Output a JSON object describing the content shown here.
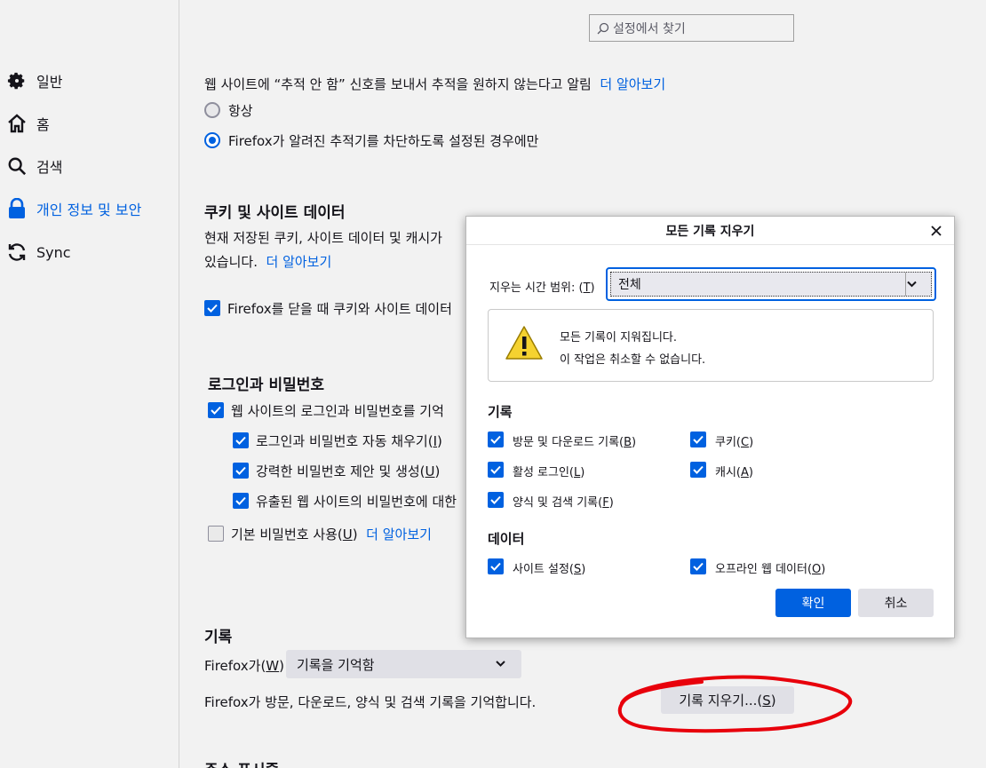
{
  "search": {
    "placeholder": "설정에서 찾기"
  },
  "sidebar": {
    "items": [
      {
        "label": "일반",
        "icon": "gear-icon"
      },
      {
        "label": "홈",
        "icon": "home-icon"
      },
      {
        "label": "검색",
        "icon": "search-icon"
      },
      {
        "label": "개인 정보 및 보안",
        "icon": "lock-icon",
        "selected": true
      },
      {
        "label": "Sync",
        "icon": "sync-icon"
      }
    ]
  },
  "dnt": {
    "text": "웹 사이트에 “추적 안 함” 신호를 보내서 추적을 원하지 않는다고 알림",
    "learn_more": "더 알아보기",
    "option_always": "항상",
    "option_only": "Firefox가 알려진 추적기를 차단하도록 설정된 경우에만"
  },
  "cookies": {
    "title": "쿠키 및 사이트 데이터",
    "desc1": "현재 저장된 쿠키, 사이트 데이터 및 캐시가",
    "desc2": "있습니다.",
    "learn_more": "더 알아보기",
    "delete_on_close": "Firefox를 닫을 때 쿠키와 사이트 데이터"
  },
  "logins": {
    "title": "로그인과 비밀번호",
    "ask_save": "웹 사이트의 로그인과 비밀번호를 기억",
    "autofill": "로그인과 비밀번호 자동 채우기(",
    "autofill_key": "I",
    "suggest": "강력한 비밀번호 제안 및 생성(",
    "suggest_key": "U",
    "breach": "유출된 웹 사이트의 비밀번호에 대한",
    "primary_pw": "기본 비밀번호 사용(",
    "primary_pw_key": "U",
    "learn_more": "더 알아보기"
  },
  "history": {
    "title": "기록",
    "firefox_will_label": "Firefox가(",
    "firefox_will_key": "W",
    "mode_value": "기록을 기억함",
    "desc": "Firefox가 방문, 다운로드, 양식 및 검색 기록을 기억합니다.",
    "clear_button": "기록 지우기...(",
    "clear_button_key": "S"
  },
  "next_section_partial": "주소 표시줄",
  "dialog": {
    "title": "모든 기록 지우기",
    "range_label": "지우는 시간 범위: (",
    "range_key": "T",
    "range_value": "전체",
    "warning_line1": "모든 기록이 지워집니다.",
    "warning_line2": "이 작업은 취소할 수 없습니다.",
    "history_heading": "기록",
    "data_heading": "데이터",
    "items": {
      "browsing": {
        "label": "방문 및 다운로드 기록(",
        "key": "B",
        "checked": true
      },
      "cookies": {
        "label": "쿠키(",
        "key": "C",
        "checked": true
      },
      "logins": {
        "label": "활성 로그인(",
        "key": "L",
        "checked": true
      },
      "cache": {
        "label": "캐시(",
        "key": "A",
        "checked": true
      },
      "forms": {
        "label": "양식 및 검색 기록(",
        "key": "F",
        "checked": true
      },
      "site_settings": {
        "label": "사이트 설정(",
        "key": "S",
        "checked": true
      },
      "offline": {
        "label": "오프라인 웹 데이터(",
        "key": "O",
        "checked": true
      }
    },
    "ok": "확인",
    "cancel": "취소"
  },
  "colors": {
    "accent": "#0061e0",
    "annotation": "#e8000b"
  }
}
